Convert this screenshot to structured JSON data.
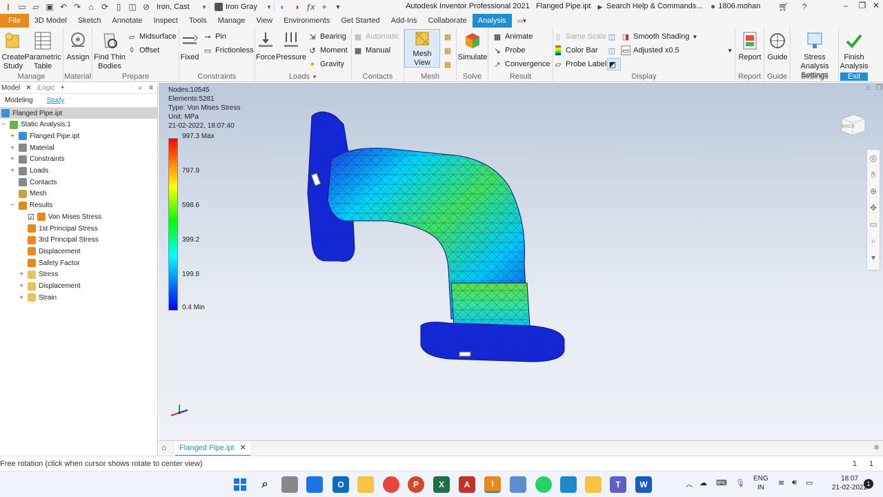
{
  "titlebar": {
    "material": "Iron, Cast",
    "appearance": "Iron Gray",
    "title": "Autodesk Inventor Professional 2021",
    "document": "Flanged Pipe.ipt",
    "search_placeholder": "Search Help & Commands...",
    "user": "1806.mohan"
  },
  "tabs": [
    "File",
    "3D Model",
    "Sketch",
    "Annotate",
    "Inspect",
    "Tools",
    "Manage",
    "View",
    "Environments",
    "Get Started",
    "Add-Ins",
    "Collaborate",
    "Analysis"
  ],
  "ribbon": {
    "manage": {
      "label": "Manage",
      "create_study": "Create\nStudy",
      "parametric_table": "Parametric\nTable"
    },
    "material": {
      "label": "Material",
      "assign": "Assign"
    },
    "prepare": {
      "label": "Prepare",
      "find_thin_bodies": "Find Thin\nBodies",
      "midsurface": "Midsurface",
      "offset": "Offset"
    },
    "constraints": {
      "label": "Constraints",
      "fixed": "Fixed",
      "pin": "Pin",
      "frictionless": "Frictionless"
    },
    "loads": {
      "label": "Loads",
      "force": "Force",
      "pressure": "Pressure",
      "bearing": "Bearing",
      "moment": "Moment",
      "gravity": "Gravity"
    },
    "contacts": {
      "label": "Contacts",
      "automatic": "Automatic",
      "manual": "Manual"
    },
    "mesh": {
      "label": "Mesh",
      "mesh_view": "Mesh View"
    },
    "solve": {
      "label": "Solve",
      "simulate": "Simulate"
    },
    "result": {
      "label": "Result",
      "animate": "Animate",
      "probe": "Probe",
      "convergence": "Convergence"
    },
    "display": {
      "label": "Display",
      "same_scale": "Same Scale",
      "color_bar": "Color Bar",
      "probe_labels": "Probe Labels",
      "smooth_shading": "Smooth Shading",
      "adjusted": "Adjusted x0.5"
    },
    "report": {
      "label": "Report",
      "report": "Report"
    },
    "guide": {
      "label": "Guide",
      "guide": "Guide"
    },
    "settings": {
      "label": "Settings",
      "stress_settings": "Stress Analysis\nSettings"
    },
    "exit": {
      "label": "Exit",
      "finish": "Finish\nAnalysis"
    }
  },
  "browser": {
    "tab_model": "Model",
    "tab_ilogic": "iLogic",
    "sub_modeling": "Modeling",
    "sub_study": "Study",
    "tree": [
      {
        "label": "Flanged Pipe.ipt",
        "indent": 0,
        "exp": "",
        "selected": true,
        "color": "#3d8fd6"
      },
      {
        "label": "Static Analysis:1",
        "indent": 0,
        "exp": "−",
        "color": "#6ab04c"
      },
      {
        "label": "Flanged Pipe.ipt",
        "indent": 1,
        "exp": "+",
        "color": "#3d8fd6"
      },
      {
        "label": "Material",
        "indent": 1,
        "exp": "+",
        "color": "#888"
      },
      {
        "label": "Constraints",
        "indent": 1,
        "exp": "+",
        "color": "#888"
      },
      {
        "label": "Loads",
        "indent": 1,
        "exp": "+",
        "color": "#888"
      },
      {
        "label": "Contacts",
        "indent": 1,
        "exp": "",
        "color": "#888"
      },
      {
        "label": "Mesh",
        "indent": 1,
        "exp": "",
        "color": "#c9a23f"
      },
      {
        "label": "Results",
        "indent": 1,
        "exp": "−",
        "color": "#e8891c"
      },
      {
        "label": "Von Mises Stress",
        "indent": 2,
        "exp": "",
        "check": true,
        "color": "#e8891c"
      },
      {
        "label": "1st Principal Stress",
        "indent": 2,
        "exp": "",
        "color": "#e8891c"
      },
      {
        "label": "3rd Principal Stress",
        "indent": 2,
        "exp": "",
        "color": "#e8891c"
      },
      {
        "label": "Displacement",
        "indent": 2,
        "exp": "",
        "color": "#e8891c"
      },
      {
        "label": "Safety Factor",
        "indent": 2,
        "exp": "",
        "color": "#e8891c"
      },
      {
        "label": "Stress",
        "indent": 2,
        "exp": "+",
        "folder": true,
        "color": "#e8c35a"
      },
      {
        "label": "Displacement",
        "indent": 2,
        "exp": "+",
        "folder": true,
        "color": "#e8c35a"
      },
      {
        "label": "Strain",
        "indent": 2,
        "exp": "+",
        "folder": true,
        "color": "#e8c35a"
      }
    ]
  },
  "viewport": {
    "info": [
      "Nodes:10545",
      "Elements:5281",
      "Type: Von Mises Stress",
      "Unit: MPa",
      "21-02-2022, 18:07:40"
    ],
    "colorbar": [
      "997.3 Max",
      "797.9",
      "598.6",
      "399.2",
      "199.8",
      "0.4 Min"
    ],
    "viewcube_label": "BACK"
  },
  "doctab": "Flanged Pipe.ipt",
  "status": {
    "message": "Free rotation (click when cursor shows rotate to center view)",
    "count1": "1",
    "count2": "1"
  },
  "taskbar": {
    "lang": "ENG",
    "region": "IN",
    "time": "18:07",
    "date": "21-02-2022",
    "notif": "1"
  },
  "colors": {
    "accent": "#1e8fd6",
    "file_tab": "#e8891c"
  }
}
